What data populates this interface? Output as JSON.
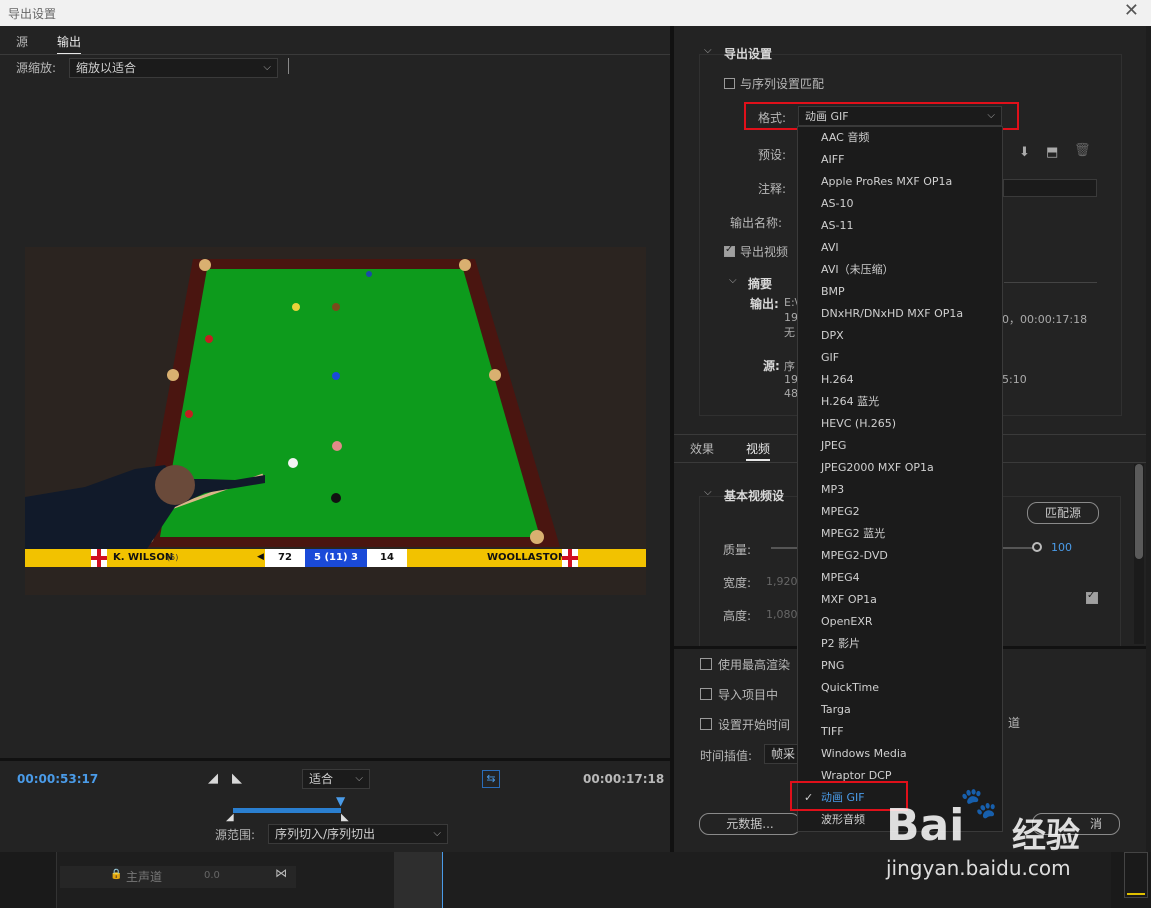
{
  "window": {
    "title": "导出设置"
  },
  "left": {
    "tabs": [
      {
        "label": "源"
      },
      {
        "label": "输出"
      }
    ],
    "source_scale_label": "源缩放:",
    "source_scale_value": "缩放以适合",
    "timecode_start": "00:00:53:17",
    "timecode_end": "00:00:17:18",
    "fit_value": "适合",
    "source_range_label": "源范围:",
    "source_range_value": "序列切入/序列切出"
  },
  "video": {
    "score_left_name": "K. WILSON",
    "score_left_sub": "(5)",
    "score_left_points": "72",
    "score_frames": "5 (11) 3",
    "score_right_points": "14",
    "score_right_name": "WOOLLASTON"
  },
  "export": {
    "section_title": "导出设置",
    "match_sequence_label": "与序列设置匹配",
    "format_label": "格式:",
    "format_value": "动画 GIF",
    "preset_label": "预设:",
    "comments_label": "注释:",
    "output_name_label": "输出名称:",
    "export_video_label": "导出视频",
    "summary_title": "摘要",
    "output_label": "输出:",
    "output_line1": "E:\\",
    "output_line2": "192",
    "output_line2_tail": "0，00:00:17:18",
    "output_line3": "无",
    "source_label": "源:",
    "source_line1": "序",
    "source_line2": "192",
    "source_line2_tail": "5:10",
    "source_line3": "480"
  },
  "video_tabs": [
    {
      "label": "效果"
    },
    {
      "label": "视频"
    }
  ],
  "basic_video": {
    "title": "基本视频设",
    "match_source_button": "匹配源",
    "quality_label": "质量:",
    "quality_value": "100",
    "width_label": "宽度:",
    "width_value": "1,920",
    "height_label": "高度:",
    "height_value": "1,080"
  },
  "options": {
    "max_render_label": "使用最高渲染",
    "import_project_label": "导入项目中",
    "set_start_tc_label": "设置开始时间",
    "channel_suffix": "道",
    "time_interp_label": "时间插值:",
    "time_interp_value": "帧采",
    "metadata_button": "元数据...",
    "cancel_button": "消"
  },
  "format_menu": {
    "items": [
      "AAC 音频",
      "AIFF",
      "Apple ProRes MXF OP1a",
      "AS-10",
      "AS-11",
      "AVI",
      "AVI（未压缩）",
      "BMP",
      "DNxHR/DNxHD MXF OP1a",
      "DPX",
      "GIF",
      "H.264",
      "H.264 蓝光",
      "HEVC (H.265)",
      "JPEG",
      "JPEG2000 MXF OP1a",
      "MP3",
      "MPEG2",
      "MPEG2 蓝光",
      "MPEG2-DVD",
      "MPEG4",
      "MXF OP1a",
      "OpenEXR",
      "P2 影片",
      "PNG",
      "QuickTime",
      "Targa",
      "TIFF",
      "Windows Media",
      "Wraptor DCP",
      "动画 GIF",
      "波形音频"
    ],
    "selected_index": 30
  },
  "timeline": {
    "track_label": "主声道",
    "track_value": "0.0"
  },
  "watermark": {
    "brand": "Bai",
    "brand_cn": "经验",
    "url": "jingyan.baidu.com"
  },
  "colors": {
    "accent": "#4a9be8",
    "highlight": "#e0101a",
    "felt": "#0d9b1c",
    "scorebar": "#f2c200"
  }
}
